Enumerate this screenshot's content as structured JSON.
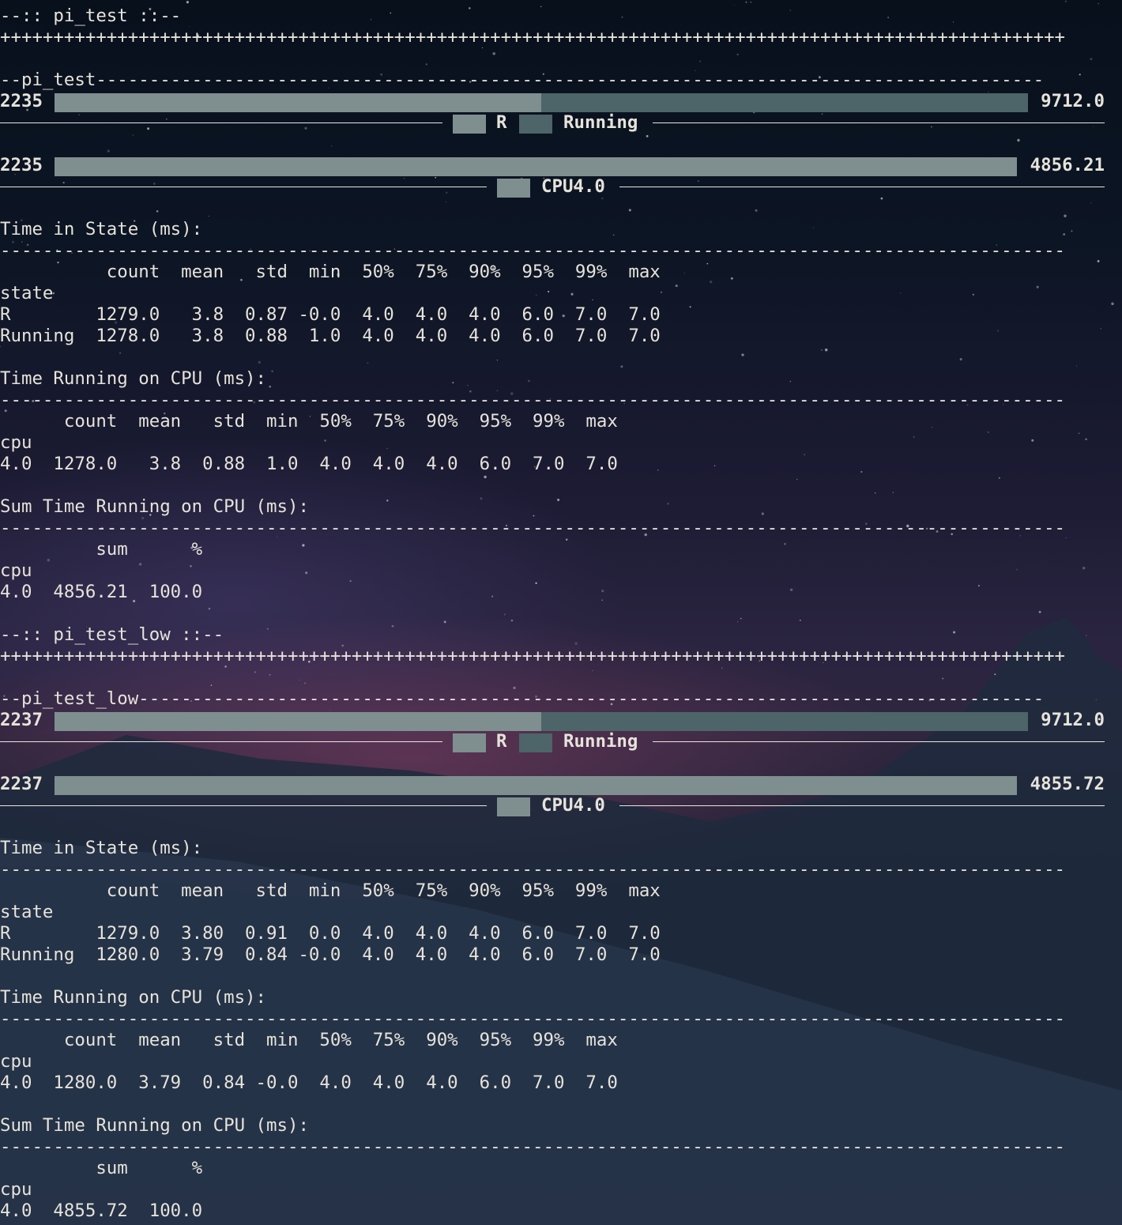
{
  "theme": {
    "bar_light": "#7f8f90",
    "bar_dark": "#4d6468",
    "text": "#e6e3da"
  },
  "tasks": [
    {
      "header": "--:: pi_test ::--",
      "plus_rule": "++++++++++++++++++++++++++++++++++++++++++++++++++++++++++++++++++++++++++++++++++++++++++++++++++++",
      "subheader": "--pi_test-----------------------------------------------------------------------------------------",
      "state_bar": {
        "left_label": "2235",
        "right_label": "9712.0",
        "segments": [
          {
            "name": "R",
            "fraction": 0.5,
            "color": "#7f8f90"
          },
          {
            "name": "Running",
            "fraction": 0.5,
            "color": "#4d6468"
          }
        ],
        "legend": [
          "R",
          "Running"
        ]
      },
      "cpu_bar": {
        "left_label": "2235",
        "right_label": "4856.21",
        "segments": [
          {
            "name": "CPU4.0",
            "fraction": 1.0,
            "color": "#7f8f90"
          }
        ],
        "legend": [
          "CPU4.0"
        ]
      },
      "state_table": {
        "title": "Time in State (ms):",
        "rule": "----------------------------------------------------------------------------------------------------",
        "header": "          count  mean   std  min  50%  75%  90%  95%  99%  max",
        "index_name": "state",
        "rows": [
          "R        1279.0   3.8  0.87 -0.0  4.0  4.0  4.0  6.0  7.0  7.0",
          "Running  1278.0   3.8  0.88  1.0  4.0  4.0  4.0  6.0  7.0  7.0"
        ]
      },
      "cpu_table": {
        "title": "Time Running on CPU (ms):",
        "rule": "----------------------------------------------------------------------------------------------------",
        "header": "      count  mean   std  min  50%  75%  90%  95%  99%  max",
        "index_name": "cpu",
        "rows": [
          "4.0  1278.0   3.8  0.88  1.0  4.0  4.0  4.0  6.0  7.0  7.0"
        ]
      },
      "sum_table": {
        "title": "Sum Time Running on CPU (ms):",
        "rule": "----------------------------------------------------------------------------------------------------",
        "header": "         sum      %",
        "index_name": "cpu",
        "rows": [
          "4.0  4856.21  100.0"
        ]
      }
    },
    {
      "header": "--:: pi_test_low ::--",
      "plus_rule": "++++++++++++++++++++++++++++++++++++++++++++++++++++++++++++++++++++++++++++++++++++++++++++++++++++",
      "subheader": "--pi_test_low-------------------------------------------------------------------------------------",
      "state_bar": {
        "left_label": "2237",
        "right_label": "9712.0",
        "segments": [
          {
            "name": "R",
            "fraction": 0.5,
            "color": "#7f8f90"
          },
          {
            "name": "Running",
            "fraction": 0.5,
            "color": "#4d6468"
          }
        ],
        "legend": [
          "R",
          "Running"
        ]
      },
      "cpu_bar": {
        "left_label": "2237",
        "right_label": "4855.72",
        "segments": [
          {
            "name": "CPU4.0",
            "fraction": 1.0,
            "color": "#7f8f90"
          }
        ],
        "legend": [
          "CPU4.0"
        ]
      },
      "state_table": {
        "title": "Time in State (ms):",
        "rule": "----------------------------------------------------------------------------------------------------",
        "header": "          count  mean   std  min  50%  75%  90%  95%  99%  max",
        "index_name": "state",
        "rows": [
          "R        1279.0  3.80  0.91  0.0  4.0  4.0  4.0  6.0  7.0  7.0",
          "Running  1280.0  3.79  0.84 -0.0  4.0  4.0  4.0  6.0  7.0  7.0"
        ]
      },
      "cpu_table": {
        "title": "Time Running on CPU (ms):",
        "rule": "----------------------------------------------------------------------------------------------------",
        "header": "      count  mean   std  min  50%  75%  90%  95%  99%  max",
        "index_name": "cpu",
        "rows": [
          "4.0  1280.0  3.79  0.84 -0.0  4.0  4.0  4.0  6.0  7.0  7.0"
        ]
      },
      "sum_table": {
        "title": "Sum Time Running on CPU (ms):",
        "rule": "----------------------------------------------------------------------------------------------------",
        "header": "         sum      %",
        "index_name": "cpu",
        "rows": [
          "4.0  4855.72  100.0"
        ]
      }
    }
  ]
}
